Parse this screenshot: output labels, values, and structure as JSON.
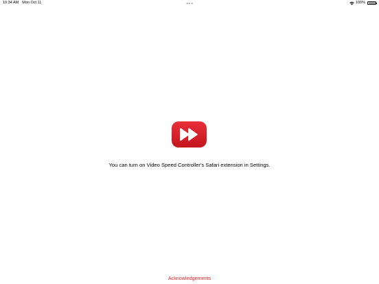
{
  "status_bar": {
    "time": "10:34 AM",
    "date": "Mon Oct 11",
    "battery_percent": "100%",
    "battery_level": 1.0
  },
  "main": {
    "app_icon": "fast-forward-icon",
    "message": "You can turn on Video Speed Controller's Safari extension in Settings."
  },
  "footer": {
    "acknowledgements_label": "Acknowledgements"
  },
  "colors": {
    "accent": "#e0262c",
    "icon_red": "#d71920",
    "background": "#ffffff"
  }
}
